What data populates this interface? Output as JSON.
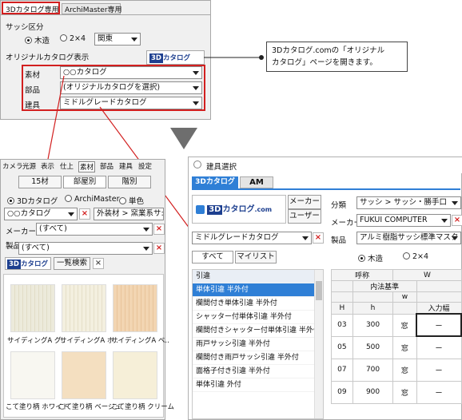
{
  "top_panel": {
    "tabs": [
      "3Dカタログ専用",
      "ArchiMaster専用"
    ],
    "sash_label": "サッシ区分",
    "radio_wood": "木造",
    "radio_2x4": "2×4",
    "region_value": "関東",
    "original_catalog_label": "オリジナルカタログ表示",
    "logo_3d": "3D",
    "logo_katalog": "カタログ",
    "rows": [
      {
        "label": "素材",
        "value": "○○カタログ"
      },
      {
        "label": "部品",
        "value": "(オリジナルカタログを選択)"
      },
      {
        "label": "建具",
        "value": "ミドルグレードカタログ"
      }
    ]
  },
  "callout": {
    "text_line1": "3Dカタログ.comの「オリジナル",
    "text_line2": "カタログ」ページを開きます。"
  },
  "left_panel": {
    "tabs": [
      "カメラ",
      "光源",
      "表示",
      "仕上",
      "素材",
      "部品",
      "建具",
      "設定"
    ],
    "subtabs": [
      "15材",
      "部屋別",
      "階別"
    ],
    "radio_3d": "3Dカタログ",
    "radio_am": "ArchiMaster",
    "radio_color": "単色",
    "catalog_value": "○○カタログ",
    "category_value": "外装材 > 窯業系サ:",
    "maker_label": "メーカー",
    "maker_value": "(すべて)",
    "product_label": "製品",
    "product_value": "(すべて)",
    "list_search": "一覧検索",
    "swatches": [
      {
        "label": "サイディングA グ..",
        "color": "#eceadb"
      },
      {
        "label": "サイディングA ホ..",
        "color": "#f3efdf"
      },
      {
        "label": "サイディングA ベ..",
        "color": "#f2d5b2"
      },
      {
        "label": "こて塗り柄 ホワイト",
        "color": "#f8f7f1"
      },
      {
        "label": "こて塗り柄 ベージュ",
        "color": "#f4dfc0"
      },
      {
        "label": "こて塗り柄 クリーム",
        "color": "#f6efd8"
      }
    ]
  },
  "dialog": {
    "title": "建具選択",
    "tab_3d": "3Dカタログ",
    "tab_am": "AM",
    "logo_text": "3Dカタログ",
    "logo_com": ".com",
    "maker_btn": "メーカー",
    "user_btn": "ユーザー",
    "catalog_value": "ミドルグレードカタログ",
    "btn_all": "すべて",
    "btn_mylist": "マイリスト",
    "list_header": "引違",
    "list_items": [
      "単体引違 半外付",
      "欄間付き単体引違 半外付",
      "シャッター付単体引違 半外付",
      "欄間付きシャッター付単体引違 半外付",
      "雨戸サッシ引違 半外付",
      "欄間付き雨戸サッシ引違 半外付",
      "面格子付き引違 半外付",
      "単体引違 外付"
    ],
    "bunrui_label": "分類",
    "bunrui_value": "サッシ > サッシ・勝手口",
    "maker_label": "メーカー",
    "maker_value": "FUKUI COMPUTER",
    "product_label": "製品",
    "product_value": "アルミ樹脂サッシ標準マスタ",
    "radio_wood": "木造",
    "radio_2x4": "2×4",
    "grid": {
      "col_call": "呼称",
      "col_W": "W",
      "col_inner": "内法基準",
      "col_w": "w",
      "col_H": "H",
      "col_h": "h",
      "col_input": "入力幅",
      "rows": [
        {
          "H": "03",
          "h": "300",
          "k": "窓",
          "v": "ー"
        },
        {
          "H": "05",
          "h": "500",
          "k": "窓",
          "v": "ー"
        },
        {
          "H": "07",
          "h": "700",
          "k": "窓",
          "v": "ー"
        },
        {
          "H": "09",
          "h": "900",
          "k": "窓",
          "v": "ー"
        }
      ]
    }
  },
  "colors": {
    "accent_red": "#d21f1f",
    "highlight_blue": "#2f7fd6",
    "logo_blue": "#1d3f8f",
    "arrow_gray": "#6e6e6e"
  }
}
